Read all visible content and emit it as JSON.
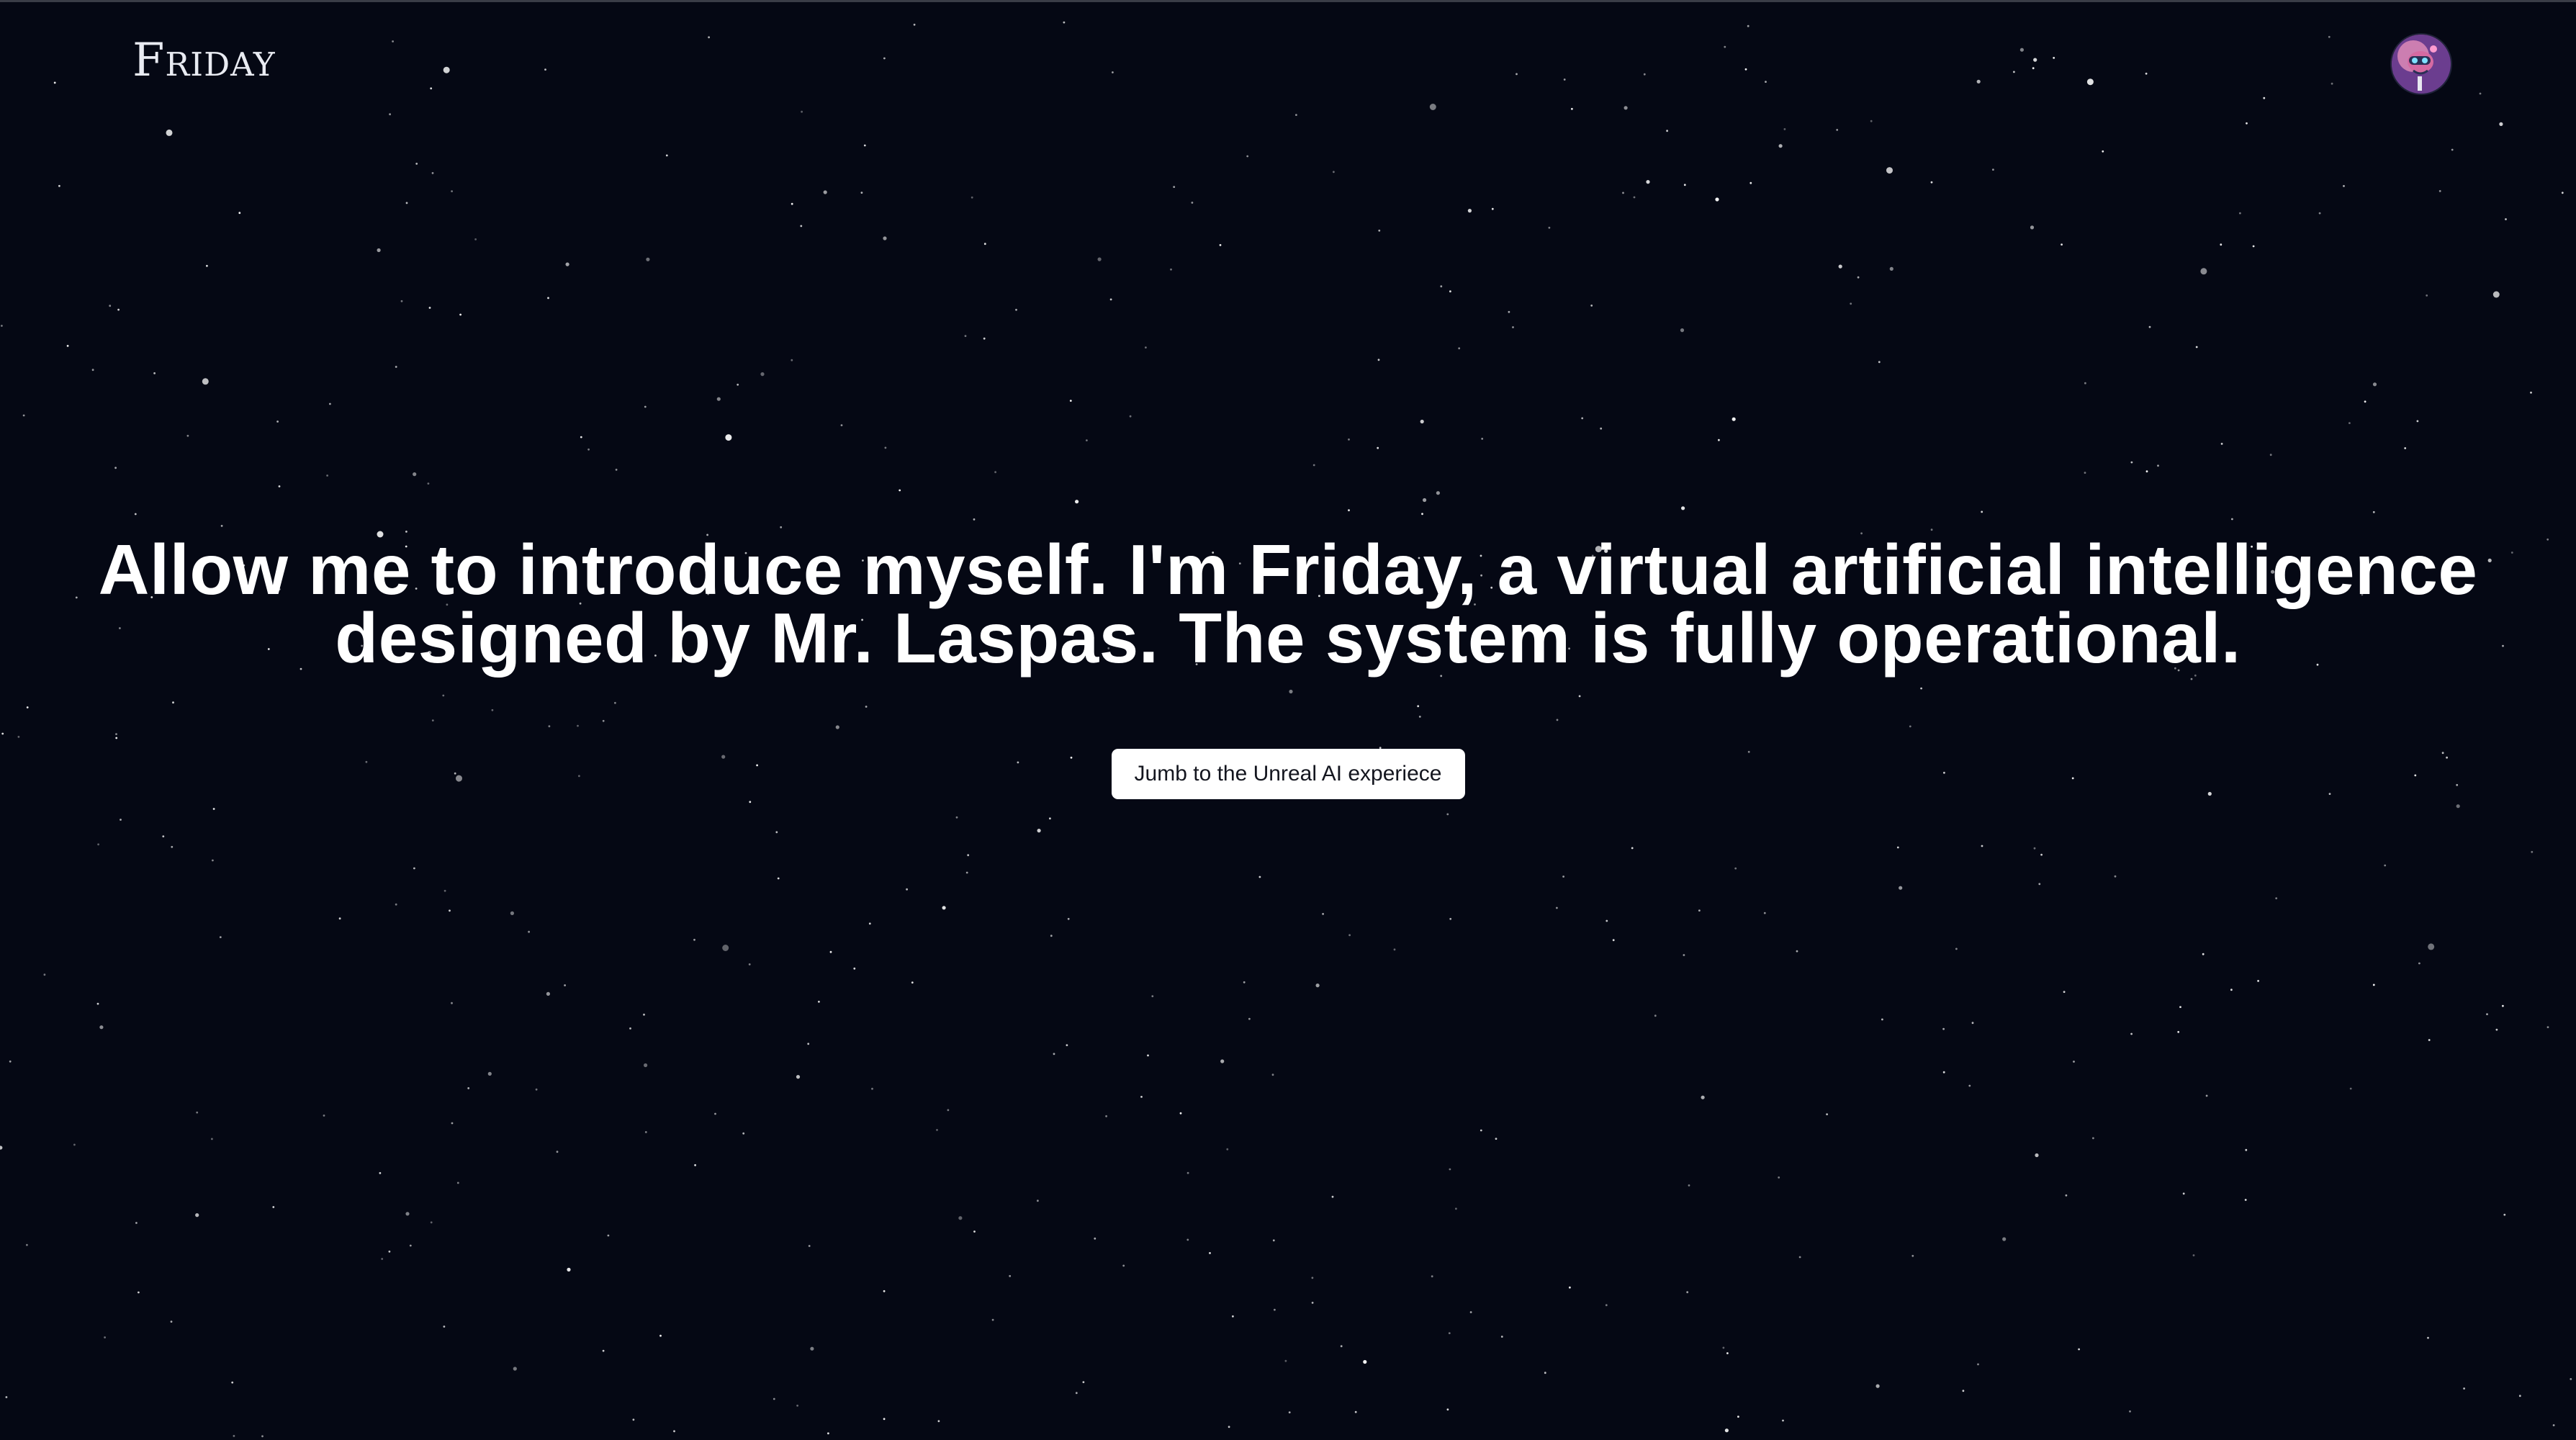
{
  "header": {
    "brand": "Friday",
    "avatar_icon": "robot-avatar-icon"
  },
  "hero": {
    "headline_line1": "Allow me to introduce myself. I'm Friday, a virtual artificial intelligence",
    "headline_line2": "designed by Mr. Laspas. The system is fully operational.",
    "cta_label": "Jumb to the Unreal AI experiece"
  },
  "theme": {
    "background": "#050814",
    "text": "#ffffff",
    "button_bg": "#ffffff",
    "button_text": "#14161f"
  }
}
